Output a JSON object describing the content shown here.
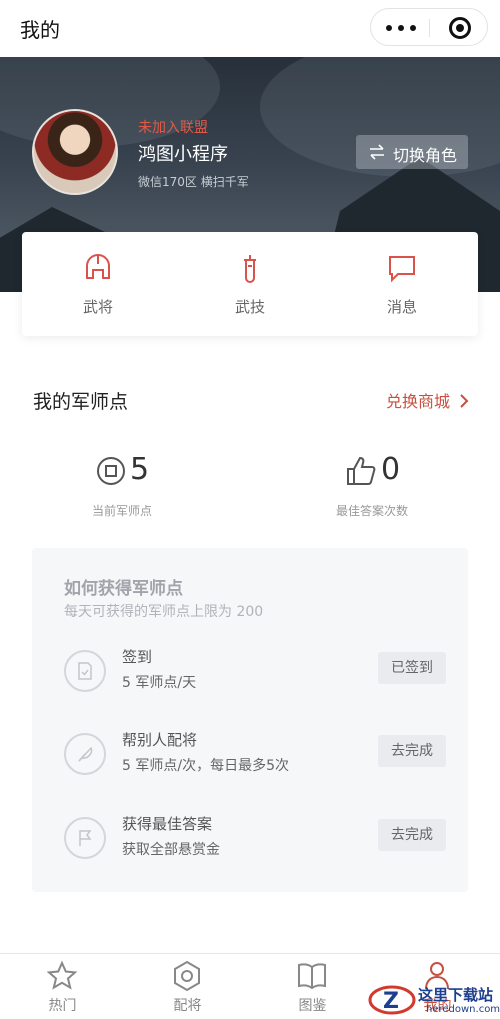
{
  "navbar": {
    "title": "我的"
  },
  "profile": {
    "alliance_status": "未加入联盟",
    "nickname": "鸿图小程序",
    "server_info": "微信170区 横扫千军",
    "switch_role_label": "切换角色"
  },
  "quick_menu": [
    {
      "label": "武将",
      "icon": "helmet-icon"
    },
    {
      "label": "武技",
      "icon": "sword-icon"
    },
    {
      "label": "消息",
      "icon": "message-icon"
    }
  ],
  "points": {
    "title": "我的军师点",
    "shop_link": "兑换商城",
    "current_value": "5",
    "current_caption": "当前军师点",
    "best_answer_value": "0",
    "best_answer_caption": "最佳答案次数"
  },
  "howto": {
    "title": "如何获得军师点",
    "subtitle": "每天可获得的军师点上限为 200",
    "tasks": [
      {
        "name": "签到",
        "desc": "5 军师点/天",
        "button": "已签到",
        "icon": "checkin-icon"
      },
      {
        "name": "帮别人配将",
        "desc": "5 军师点/次，每日最多5次",
        "button": "去完成",
        "icon": "feather-icon"
      },
      {
        "name": "获得最佳答案",
        "desc": "获取全部悬赏金",
        "button": "去完成",
        "icon": "flag-icon"
      }
    ]
  },
  "tabbar": [
    {
      "label": "热门",
      "icon": "star-icon"
    },
    {
      "label": "配将",
      "icon": "hexagon-icon"
    },
    {
      "label": "图鉴",
      "icon": "book-icon"
    },
    {
      "label": "我的",
      "icon": "user-icon",
      "active": true
    }
  ],
  "watermark": {
    "main": "这里下载站",
    "sub": "heredown.com"
  },
  "colors": {
    "accent": "#c8503f",
    "alliance": "#e05a48"
  }
}
